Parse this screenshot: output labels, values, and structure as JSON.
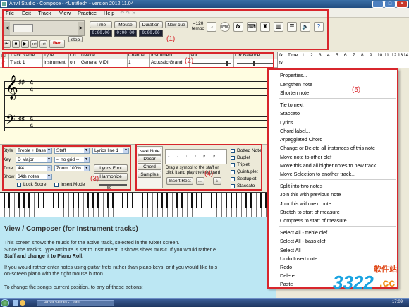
{
  "window": {
    "title": "Anvil Studio - Compose - <Untitled> - version 2012.11.04"
  },
  "menu": [
    "File",
    "Edit",
    "Track",
    "View",
    "Practice",
    "Help"
  ],
  "toolbar": {
    "time_label": "Time",
    "mouse_label": "Mouse",
    "duration_label": "Duration",
    "newcue_label": "New cue",
    "time_value": "0:00.00",
    "mouse_value": "0:00.00",
    "duration_value": "0:00.00",
    "rec_label": "Rec",
    "step_label": "step",
    "tempo_value": "=120",
    "tempo_label": "tempo",
    "sync_label": "sync",
    "fx_label": "fx"
  },
  "annotations": {
    "a1": "(1)",
    "a2": "(2)",
    "a3": "(3)",
    "a4": "(4)",
    "a5": "(5)"
  },
  "tracks": {
    "headers": [
      "Track Name",
      "Type",
      "On",
      "Device",
      "Channel",
      "Instrument",
      "Vol",
      "L/R Balance"
    ],
    "row": {
      "name": "Track 1",
      "type": "Instrument",
      "on": "on",
      "device": "General MIDI",
      "channel": "1",
      "instrument": "Acoustic Grand"
    }
  },
  "timeline": {
    "fx1": "fx",
    "fx2": "fx",
    "time_label": "Time",
    "ticks": [
      "1",
      "2",
      "3",
      "4",
      "5",
      "6",
      "7",
      "8",
      "9",
      "10",
      "11",
      "12",
      "13",
      "14",
      "15",
      "16"
    ]
  },
  "settings": {
    "style_label": "Style",
    "style_value": "Treble + Bass",
    "staff_value": "Staff",
    "lyrics_value": "Lyrics line 1",
    "key_label": "Key",
    "key_value": "D Major",
    "grid_value": "-- no grid --",
    "time_label": "Time",
    "time_value": "4/4",
    "zoom_value": "Zoom 100%",
    "lyrics_font": "Lyrics Font",
    "show_label": "Show",
    "show_value": "64th notes",
    "harmonize": "Harmonize",
    "lock_score": "Lock Score",
    "insert_mode": "Insert Mode",
    "slider_value": "50"
  },
  "notes_panel": {
    "tabs": [
      "Next Note",
      "Decor",
      "Chord",
      "Samples"
    ],
    "instructions": "Drag a symbol to the staff or click it and play the keyboard",
    "insert_rest": "Insert Rest",
    "options": [
      "Dotted Note",
      "Duplet",
      "Triplet",
      "Quintuplet",
      "Septuplet",
      "Staccato"
    ]
  },
  "help": {
    "title": "View / Composer (for Instrument tracks)",
    "lines": [
      "This screen shows the music for the active track, selected in the Mixer screen.",
      "Since the track's Type attribute is set to Instrument, it shows sheet music. If you would rather e",
      "Staff and change it to Piano Roll.",
      "If you would rather enter notes using guitar frets rather than piano keys, or if you would like to s",
      "on-screen piano with the right mouse button.",
      "To change the song's current position, to any of these actions:"
    ]
  },
  "context_menu": {
    "items": [
      "Properties...",
      "Lengthen note",
      "Shorten note",
      "Tie to next",
      "Staccato",
      "Lyrics...",
      "Chord label...",
      "Arpeggiated Chord",
      "Change or Delete all instances of this note",
      "Move note to other clef",
      "Move this and all higher notes to new track",
      "Move Selection to another track...",
      "Split into two notes",
      "Join this with previous note",
      "Join this with next note",
      "Stretch to start of measure",
      "Compress to start of measure",
      "Select All - treble clef",
      "Select All - bass clef",
      "Select All",
      "Undo Insert note",
      "Redo",
      "Delete",
      "Paste"
    ]
  },
  "taskbar": {
    "item": "Anvil Studio - Com...",
    "clock": "17:09"
  },
  "watermark": {
    "site": "软件站",
    "brand": "3322",
    "tld": ".cc"
  },
  "colors": {
    "annotation": "#d8262c",
    "help_bg": "#bce7f3",
    "staff_bg": "#fffde1"
  }
}
